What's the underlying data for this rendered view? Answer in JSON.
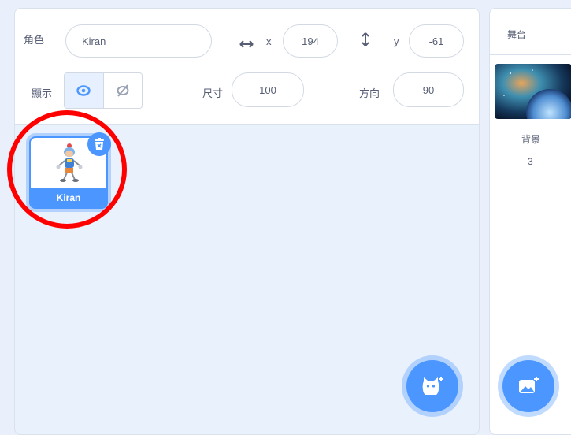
{
  "sprite_info": {
    "sprite_label": "角色",
    "sprite_name": "Kiran",
    "x_label": "x",
    "x_value": "194",
    "y_label": "y",
    "y_value": "-61",
    "show_label": "顯示",
    "size_label": "尺寸",
    "size_value": "100",
    "direction_label": "方向",
    "direction_value": "90",
    "visible": true
  },
  "sprites": [
    {
      "name": "Kiran",
      "selected": true
    }
  ],
  "stage": {
    "title": "舞台",
    "backdrops_label": "背景",
    "backdrops_count": "3"
  },
  "colors": {
    "accent": "#4c97ff",
    "highlight_circle": "#ff0000",
    "pane_background": "#e9f1fc"
  },
  "icons": {
    "horizontal_arrow": "arrows-horizontal-icon",
    "vertical_arrow": "arrows-vertical-icon",
    "show": "eye-icon",
    "hide": "eye-slash-icon",
    "delete": "trash-icon",
    "choose_sprite": "cat-plus-icon",
    "choose_backdrop": "image-plus-icon"
  }
}
